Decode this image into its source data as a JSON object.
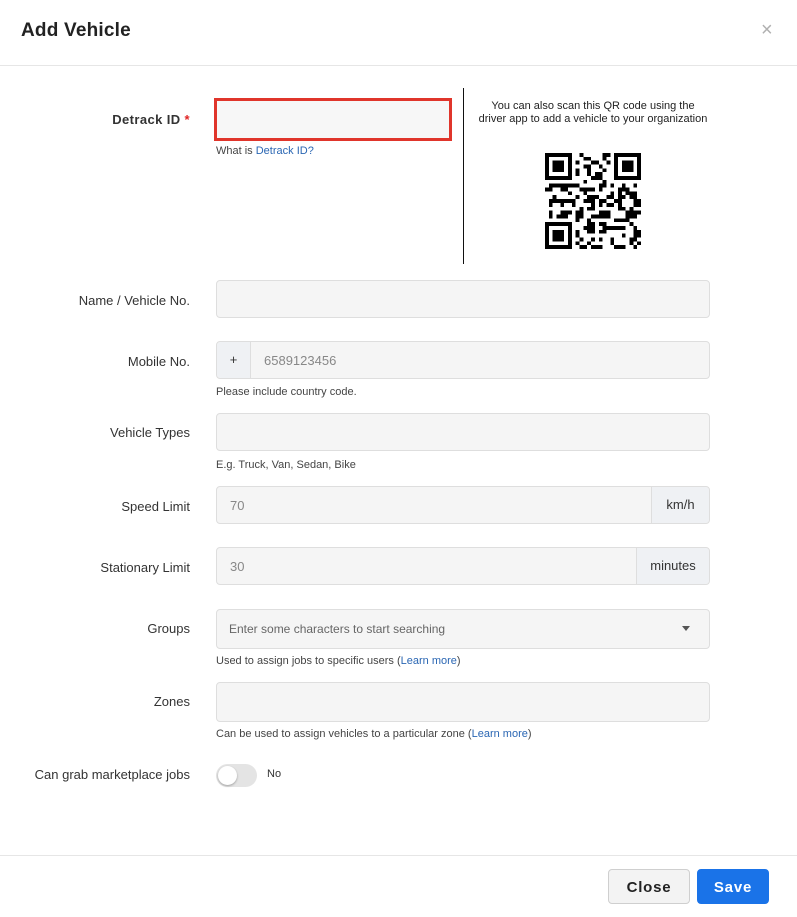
{
  "modal": {
    "title": "Add Vehicle",
    "close_glyph": "×"
  },
  "detrack": {
    "label": "Detrack ID",
    "required_mark": "*",
    "value": "",
    "help_prefix": "What is ",
    "help_link": "Detrack ID?",
    "qr_text": "You can also scan this QR code using the driver app to add a vehicle to your organization"
  },
  "fields": {
    "name": {
      "label": "Name / Vehicle No.",
      "value": ""
    },
    "mobile": {
      "label": "Mobile No.",
      "prefix": "+",
      "placeholder": "6589123456",
      "helper": "Please include country code."
    },
    "vehicle_types": {
      "label": "Vehicle Types",
      "value": "",
      "helper": "E.g. Truck, Van, Sedan, Bike"
    },
    "speed_limit": {
      "label": "Speed Limit",
      "placeholder": "70",
      "unit": "km/h"
    },
    "stationary_limit": {
      "label": "Stationary Limit",
      "placeholder": "30",
      "unit": "minutes"
    },
    "groups": {
      "label": "Groups",
      "placeholder": "Enter some characters to start searching",
      "helper_prefix": "Used to assign jobs to specific users (",
      "helper_link": "Learn more",
      "helper_suffix": ")"
    },
    "zones": {
      "label": "Zones",
      "value": "",
      "helper_prefix": "Can be used to assign vehicles to a particular zone (",
      "helper_link": "Learn more",
      "helper_suffix": ")"
    },
    "marketplace": {
      "label": "Can grab marketplace jobs",
      "toggle_on": false,
      "state_label": "No"
    }
  },
  "footer": {
    "close_label": "Close",
    "save_label": "Save"
  },
  "colors": {
    "primary": "#1a73e8",
    "error_border": "#e0352b",
    "link": "#2a66b3"
  }
}
